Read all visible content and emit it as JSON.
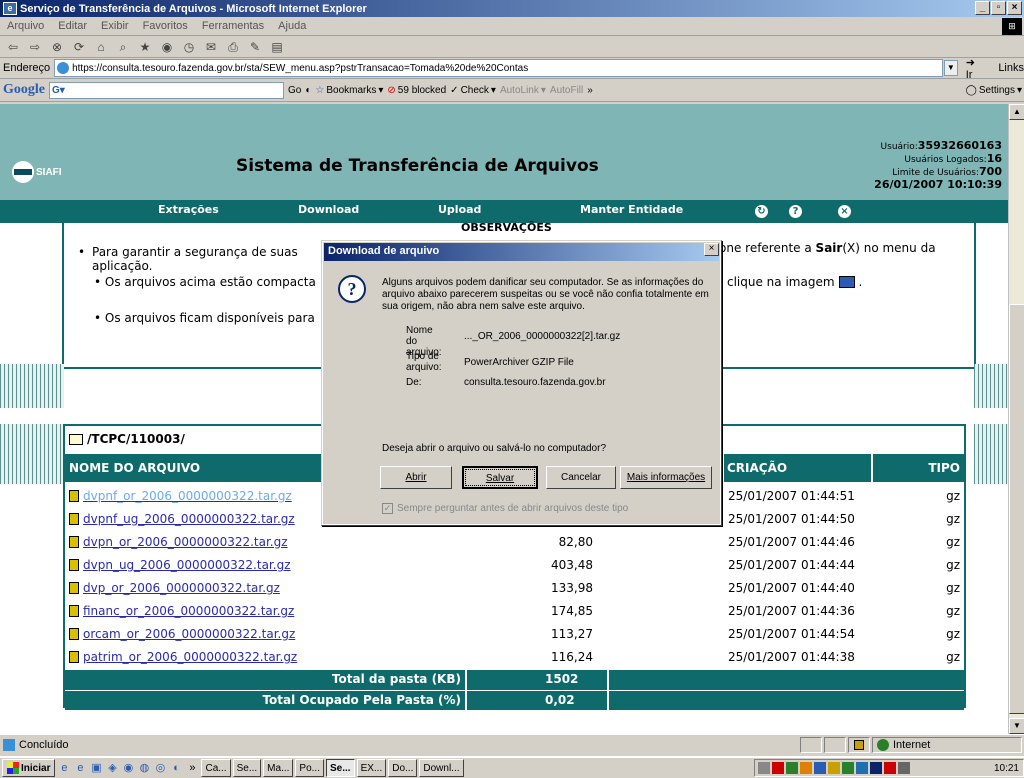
{
  "window": {
    "title": "Serviço de Transferência de Arquivos - Microsoft Internet Explorer"
  },
  "menu": [
    "Arquivo",
    "Editar",
    "Exibir",
    "Favoritos",
    "Ferramentas",
    "Ajuda"
  ],
  "address": {
    "label": "Endereço",
    "url": "https://consulta.tesouro.fazenda.gov.br/sta/SEW_menu.asp?pstrTransacao=Tomada%20de%20Contas",
    "go": "Ir",
    "links": "Links"
  },
  "googlebar": {
    "logo": "Google",
    "input": "G",
    "go": "Go",
    "bookmarks": "Bookmarks",
    "blocked": "59 blocked",
    "check": "Check",
    "autolink": "AutoLink",
    "autofill": "AutoFill",
    "more": "»",
    "settings": "Settings"
  },
  "site": {
    "logo": "SIAFI",
    "title": "Sistema de Transferência de Arquivos",
    "user_label": "Usuário:",
    "user": "35932660163",
    "logged_label": "Usuários Logados:",
    "logged": "16",
    "limit_label": "Limite de Usuários:",
    "limit": "700",
    "datetime": "26/01/2007 10:10:39"
  },
  "nav": [
    "Extrações",
    "Download",
    "Upload",
    "Manter Entidade"
  ],
  "obs": {
    "title": "OBSERVAÇÕES",
    "line1": "Para garantir a segurança de suas",
    "line1b": "aplicação.",
    "line1r_a": "one referente a ",
    "line1r_b": "Sair",
    "line1r_c": "(X) no menu da",
    "line2": "Os arquivos acima estão compacta",
    "line2r": "clique na imagem",
    "line2end": ".",
    "line3": "Os arquivos ficam disponíveis para"
  },
  "files": {
    "path": "/TCPC/110003/",
    "headers": {
      "name": "NOME DO ARQUIVO",
      "created": "CRIAÇÃO",
      "type": "TIPO"
    },
    "rows": [
      {
        "name": "dvpnf_or_2006_0000000322.tar.gz",
        "size": "",
        "date": "25/01/2007 01:44:51",
        "type": "gz"
      },
      {
        "name": "dvpnf_ug_2006_0000000322.tar.gz",
        "size": "",
        "date": "25/01/2007 01:44:50",
        "type": "gz"
      },
      {
        "name": "dvpn_or_2006_0000000322.tar.gz",
        "size": "82,80",
        "date": "25/01/2007 01:44:46",
        "type": "gz"
      },
      {
        "name": "dvpn_ug_2006_0000000322.tar.gz",
        "size": "403,48",
        "date": "25/01/2007 01:44:44",
        "type": "gz"
      },
      {
        "name": "dvp_or_2006_0000000322.tar.gz",
        "size": "133,98",
        "date": "25/01/2007 01:44:40",
        "type": "gz"
      },
      {
        "name": "financ_or_2006_0000000322.tar.gz",
        "size": "174,85",
        "date": "25/01/2007 01:44:36",
        "type": "gz"
      },
      {
        "name": "orcam_or_2006_0000000322.tar.gz",
        "size": "113,27",
        "date": "25/01/2007 01:44:54",
        "type": "gz"
      },
      {
        "name": "patrim_or_2006_0000000322.tar.gz",
        "size": "116,24",
        "date": "25/01/2007 01:44:38",
        "type": "gz"
      }
    ],
    "total_kb_label": "Total da pasta (KB)",
    "total_kb": "1502",
    "total_pct_label": "Total Ocupado Pela Pasta (%)",
    "total_pct": "0,02"
  },
  "dialog": {
    "title": "Download de arquivo",
    "warning": "Alguns arquivos podem danificar seu computador. Se as informações do arquivo abaixo parecerem suspeitas ou se você não confia totalmente em sua origem, não abra nem salve este arquivo.",
    "name_label": "Nome do arquivo:",
    "name": "..._OR_2006_0000000322[2].tar.gz",
    "type_label": "Tipo de arquivo:",
    "type": "PowerArchiver GZIP File",
    "from_label": "De:",
    "from": "consulta.tesouro.fazenda.gov.br",
    "question": "Deseja abrir o arquivo ou salvá-lo no computador?",
    "btn_open": "Abrir",
    "btn_save": "Salvar",
    "btn_cancel": "Cancelar",
    "btn_more": "Mais informações",
    "checkbox": "Sempre perguntar antes de abrir arquivos deste tipo",
    "checked": true
  },
  "status": {
    "text": "Concluído",
    "zone": "Internet"
  },
  "taskbar": {
    "start": "Iniciar",
    "tasks": [
      "Ca...",
      "Se...",
      "Ma...",
      "Po...",
      "Se...",
      "EX...",
      "Do...",
      "Downl..."
    ],
    "active_index": 4,
    "clock": "10:21"
  }
}
